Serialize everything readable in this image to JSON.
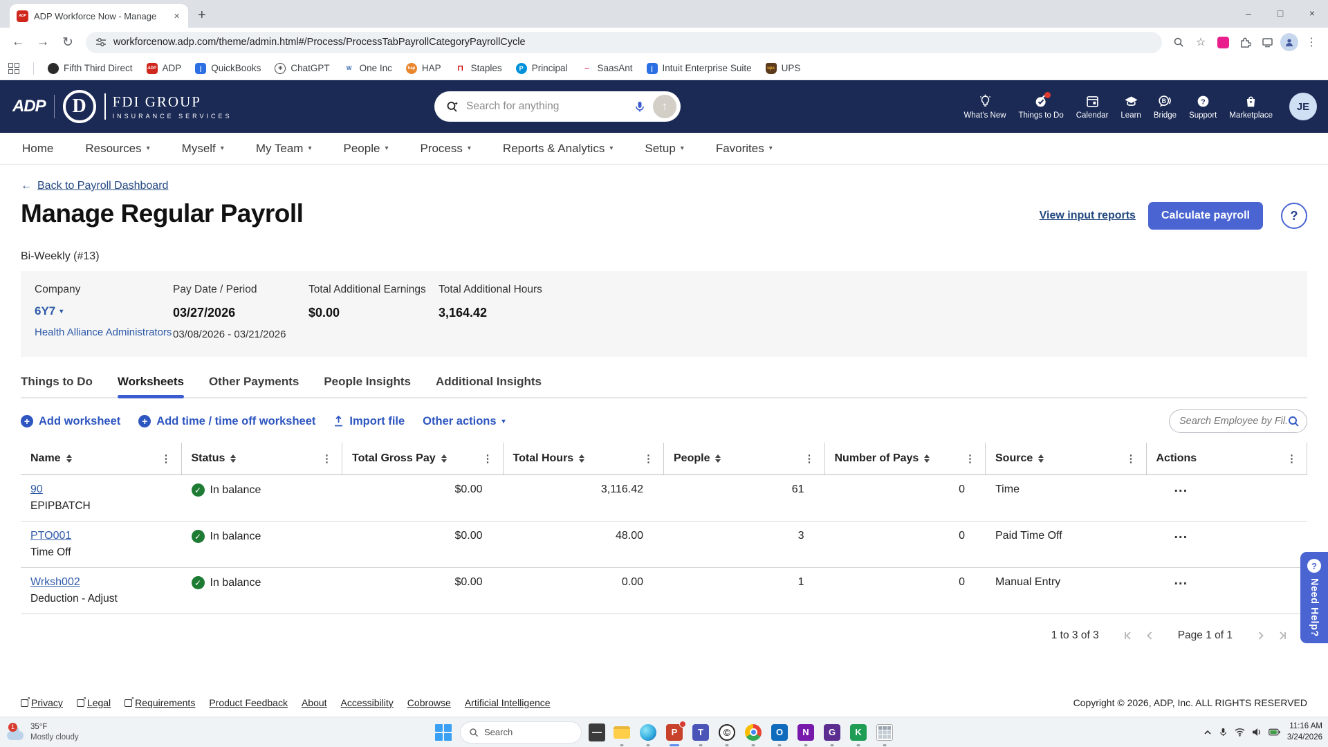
{
  "browser": {
    "tab_title": "ADP Workforce Now - Manage",
    "url": "workforcenow.adp.com/theme/admin.html#/Process/ProcessTabPayrollCategoryPayrollCycle",
    "window_controls": {
      "minimize": "–",
      "maximize": "□",
      "close": "×"
    },
    "new_tab": "+"
  },
  "bookmarks": {
    "items": [
      {
        "label": "Fifth Third Direct"
      },
      {
        "label": "ADP"
      },
      {
        "label": "QuickBooks"
      },
      {
        "label": "ChatGPT"
      },
      {
        "label": "One Inc"
      },
      {
        "label": "HAP"
      },
      {
        "label": "Staples"
      },
      {
        "label": "Principal"
      },
      {
        "label": "SaasAnt"
      },
      {
        "label": "Intuit Enterprise Suite"
      },
      {
        "label": "UPS"
      }
    ]
  },
  "header": {
    "brand_adp": "ADP",
    "brand_fdi_letter": "D",
    "brand_name": "FDI GROUP",
    "brand_tagline": "INSURANCE SERVICES",
    "search_placeholder": "Search for anything",
    "icons": [
      {
        "label": "What's New"
      },
      {
        "label": "Things to Do"
      },
      {
        "label": "Calendar"
      },
      {
        "label": "Learn"
      },
      {
        "label": "Bridge"
      },
      {
        "label": "Support"
      },
      {
        "label": "Marketplace"
      }
    ],
    "avatar": "JE"
  },
  "nav": {
    "items": [
      {
        "label": "Home"
      },
      {
        "label": "Resources"
      },
      {
        "label": "Myself"
      },
      {
        "label": "My Team"
      },
      {
        "label": "People"
      },
      {
        "label": "Process"
      },
      {
        "label": "Reports & Analytics"
      },
      {
        "label": "Setup"
      },
      {
        "label": "Favorites"
      }
    ]
  },
  "page": {
    "back_link": "Back to Payroll Dashboard",
    "title": "Manage Regular Payroll",
    "view_reports": "View input reports",
    "calculate": "Calculate payroll",
    "help": "?",
    "cycle": "Bi-Weekly (#13)",
    "summary": {
      "company_label": "Company",
      "company_code": "6Y7",
      "company_name": "Health Alliance Administrators",
      "paydate_label": "Pay Date / Period",
      "pay_date": "03/27/2026",
      "pay_period": "03/08/2026 - 03/21/2026",
      "earnings_label": "Total Additional Earnings",
      "earnings_value": "$0.00",
      "hours_label": "Total Additional Hours",
      "hours_value": "3,164.42"
    },
    "tabs": [
      {
        "label": "Things to Do"
      },
      {
        "label": "Worksheets"
      },
      {
        "label": "Other Payments"
      },
      {
        "label": "People Insights"
      },
      {
        "label": "Additional Insights"
      }
    ],
    "actions": {
      "add_worksheet": "Add worksheet",
      "add_time": "Add time / time off worksheet",
      "import_file": "Import file",
      "other_actions": "Other actions",
      "search_placeholder": "Search Employee by Fil..."
    }
  },
  "table": {
    "columns": [
      "Name",
      "Status",
      "Total Gross Pay",
      "Total Hours",
      "People",
      "Number of Pays",
      "Source",
      "Actions"
    ],
    "rows": [
      {
        "name": "90",
        "sub": "EPIPBATCH",
        "status": "In balance",
        "gross": "$0.00",
        "hours": "3,116.42",
        "people": "61",
        "pays": "0",
        "source": "Time"
      },
      {
        "name": "PTO001",
        "sub": "Time Off",
        "status": "In balance",
        "gross": "$0.00",
        "hours": "48.00",
        "people": "3",
        "pays": "0",
        "source": "Paid Time Off"
      },
      {
        "name": "Wrksh002",
        "sub": "Deduction - Adjust",
        "status": "In balance",
        "gross": "$0.00",
        "hours": "0.00",
        "people": "1",
        "pays": "0",
        "source": "Manual Entry"
      }
    ]
  },
  "pagination": {
    "range": "1 to 3 of 3",
    "page": "Page 1 of 1"
  },
  "need_help": "Need Help?",
  "footer": {
    "links": [
      {
        "label": "Privacy"
      },
      {
        "label": "Legal"
      },
      {
        "label": "Requirements"
      },
      {
        "label": "Product Feedback"
      },
      {
        "label": "About"
      },
      {
        "label": "Accessibility"
      },
      {
        "label": "Cobrowse"
      },
      {
        "label": "Artificial Intelligence"
      }
    ],
    "copyright": "Copyright © 2026, ADP, Inc. ALL RIGHTS RESERVED"
  },
  "taskbar": {
    "weather_badge": "1",
    "weather_temp": "35°F",
    "weather_cond": "Mostly cloudy",
    "search_label": "Search",
    "time": "11:16 AM",
    "date": "3/24/2026"
  },
  "colors": {
    "header_navy": "#1b2a55",
    "accent_blue": "#4a65d2",
    "link_blue": "#2e5aa8",
    "status_green": "#1e7b34",
    "badge_red": "#e03c31"
  }
}
